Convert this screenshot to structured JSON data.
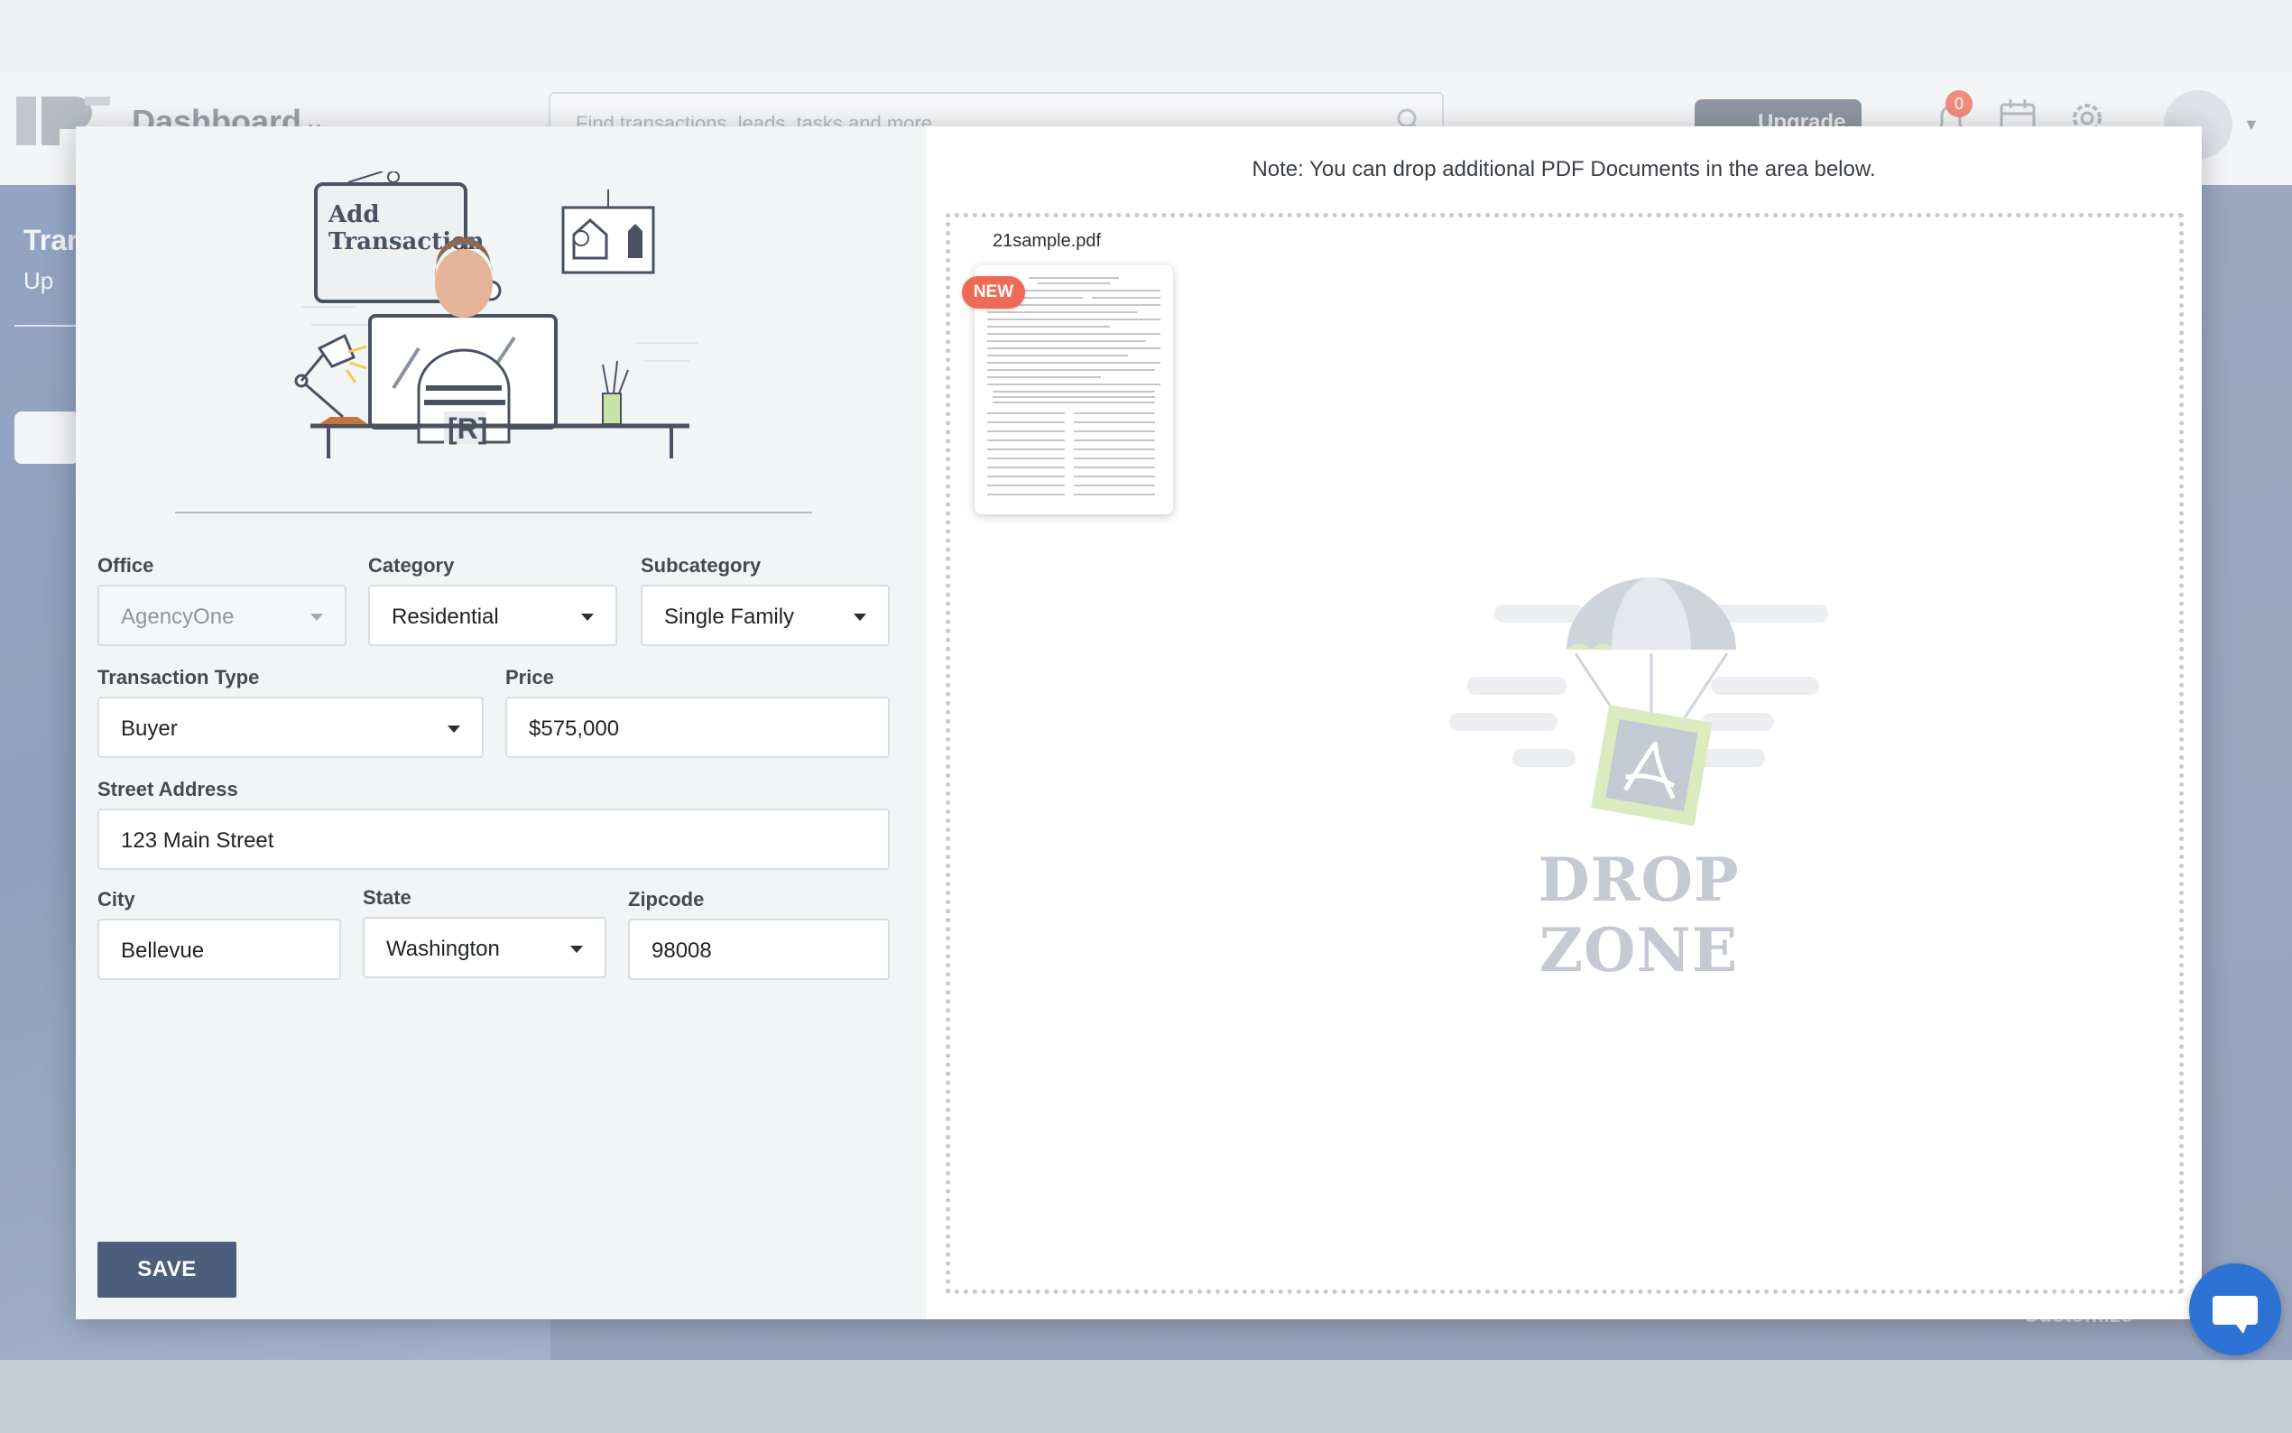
{
  "background": {
    "app_title": "Dashboard",
    "search_placeholder": "Find transactions, leads, tasks and more...",
    "upgrade_label": "Upgrade",
    "notification_count": "0",
    "sidebar_title": "Tran",
    "sidebar_sub": "Up",
    "customize_label": "Customize"
  },
  "modal": {
    "illustration_title_line1": "Add",
    "illustration_title_line2": "Transaction",
    "form": {
      "office": {
        "label": "Office",
        "value": "AgencyOne"
      },
      "category": {
        "label": "Category",
        "value": "Residential"
      },
      "subcategory": {
        "label": "Subcategory",
        "value": "Single Family"
      },
      "transaction_type": {
        "label": "Transaction Type",
        "value": "Buyer"
      },
      "price": {
        "label": "Price",
        "value": "$575,000"
      },
      "street_address": {
        "label": "Street Address",
        "value": "123 Main Street"
      },
      "city": {
        "label": "City",
        "value": "Bellevue"
      },
      "state": {
        "label": "State",
        "value": "Washington"
      },
      "zipcode": {
        "label": "Zipcode",
        "value": "98008"
      }
    },
    "save_label": "SAVE",
    "note": "Note: You can drop additional PDF Documents in the area below.",
    "document": {
      "name": "21sample.pdf",
      "badge": "NEW"
    },
    "dropzone_label": "DROP ZONE"
  },
  "colors": {
    "primary_button": "#4d5e7c",
    "new_badge": "#ee6a57",
    "chat_button": "#2d73d6"
  }
}
